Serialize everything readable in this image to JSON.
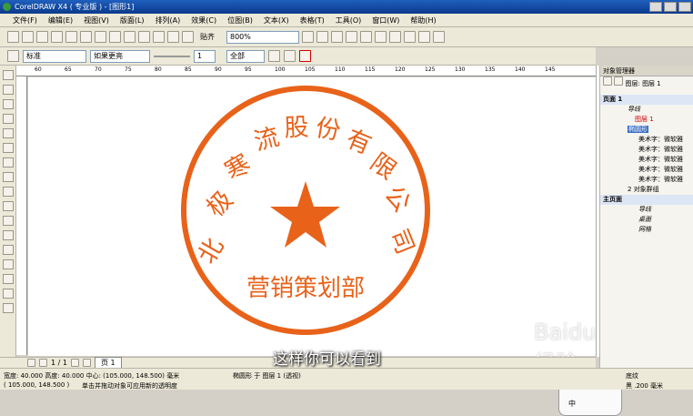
{
  "window": {
    "title": "CorelDRAW X4 ( 专业版 ) - [图形1]"
  },
  "menu": [
    "文件(F)",
    "编辑(E)",
    "视图(V)",
    "版面(L)",
    "排列(A)",
    "效果(C)",
    "位图(B)",
    "文本(X)",
    "表格(T)",
    "工具(O)",
    "窗口(W)",
    "帮助(H)"
  ],
  "toolbar": {
    "snap_label": "贴齐",
    "zoom_value": "800%"
  },
  "propbar": {
    "style_value": "标准",
    "blend_value": "如果更亮",
    "count_value": "1",
    "scope_value": "全部"
  },
  "ruler": {
    "ticks": [
      "60",
      "65",
      "70",
      "75",
      "80",
      "85",
      "90",
      "95",
      "100",
      "105",
      "110",
      "115",
      "120",
      "125",
      "130",
      "135",
      "140",
      "145"
    ]
  },
  "stamp": {
    "company_chars": [
      "北",
      "极",
      "寒",
      "流",
      "股",
      "份",
      "有",
      "限",
      "公",
      "司"
    ],
    "department": "营销策划部",
    "color": "#e8621a"
  },
  "pager": {
    "page_count": "1 / 1",
    "page_tab": "页 1"
  },
  "status": {
    "size": "宽度: 40.000  高度: 40.000  中心: (105.000, 148.500)  毫米",
    "object": "椭圆形 于 图层 1 (透视)",
    "coords": "( 105.000, 148.500 )",
    "hint": "单击并拖动对象可应用新的透明度",
    "fill_label": "底纹",
    "outline_label": "黑  .200 毫米"
  },
  "docker": {
    "title": "对象管理器",
    "layer_header": "图层:",
    "layer_name": "图层 1",
    "page1": "页面 1",
    "guides": "导线",
    "layer1": "图层 1",
    "ellipse": "椭圆形",
    "art_texts": [
      "美术字：微软雅",
      "美术字：微软雅",
      "美术字：微软雅",
      "美术字：微软雅",
      "美术字：微软雅"
    ],
    "group": "2 对象群组",
    "master": "主页面",
    "m_guides": "导线",
    "desktop": "桌面",
    "grid": "网格"
  },
  "ime": {
    "label": "中"
  },
  "subtitle": "这样你可以看到",
  "watermark": "Baidu经验"
}
